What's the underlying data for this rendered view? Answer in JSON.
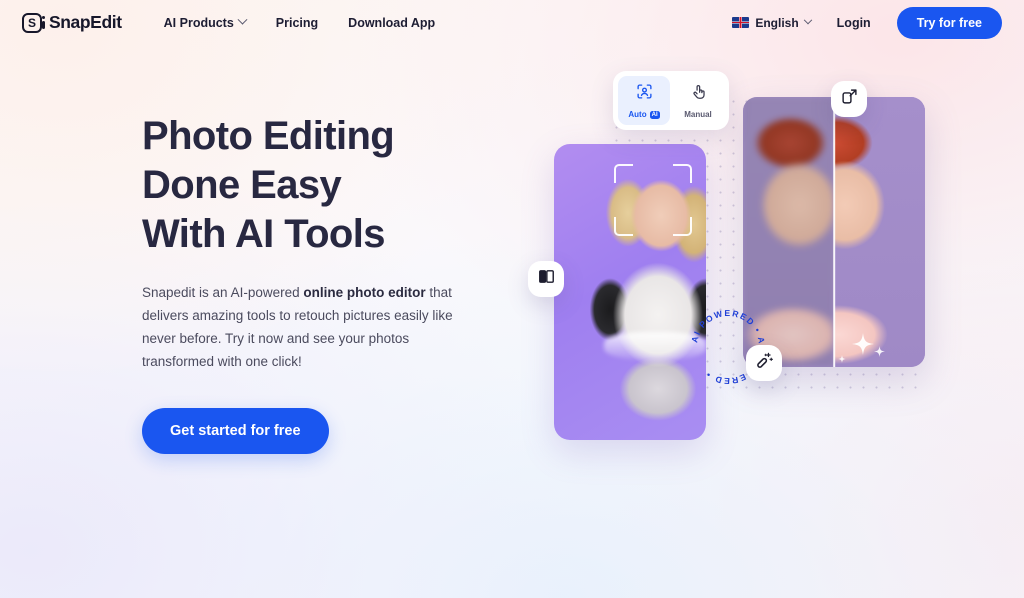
{
  "brand": {
    "name": "SnapEdit",
    "logo_glyph": "S"
  },
  "header": {
    "nav": [
      {
        "label": "AI Products",
        "has_dropdown": true
      },
      {
        "label": "Pricing",
        "has_dropdown": false
      },
      {
        "label": "Download App",
        "has_dropdown": false
      }
    ],
    "language": {
      "label": "English",
      "flag": "uk-flag-icon"
    },
    "login_label": "Login",
    "try_label": "Try for free"
  },
  "hero": {
    "headline_lines": [
      "Photo Editing",
      "Done Easy",
      "With AI Tools"
    ],
    "paragraph": {
      "before": "Snapedit is an AI-powered ",
      "bold": "online photo editor",
      "after": " that delivers amazing tools to retouch pictures easily like never before. Try it now and see your photos transformed with one click!"
    },
    "cta_label": "Get started for free"
  },
  "mode_toggle": {
    "options": [
      {
        "label": "Auto",
        "badge": "AI",
        "icon": "face-detect-icon",
        "active": true
      },
      {
        "label": "Manual",
        "badge": "",
        "icon": "hand-tap-icon",
        "active": false
      }
    ]
  },
  "floating_chips": [
    {
      "name": "expand-image-chip",
      "icon": "expand-arrow-icon"
    },
    {
      "name": "remove-background-chip",
      "icon": "layers-icon"
    },
    {
      "name": "magic-wand-chip",
      "icon": "magic-wand-icon"
    }
  ],
  "ai_badge": {
    "circular_text": "AI POWERED • AI POWERED • "
  },
  "colors": {
    "accent_blue": "#1a56f0",
    "headline": "#282841",
    "body_text": "#4b4b5e",
    "card_purple": "#a98ef2",
    "badge_blue": "#1f3fd6"
  }
}
